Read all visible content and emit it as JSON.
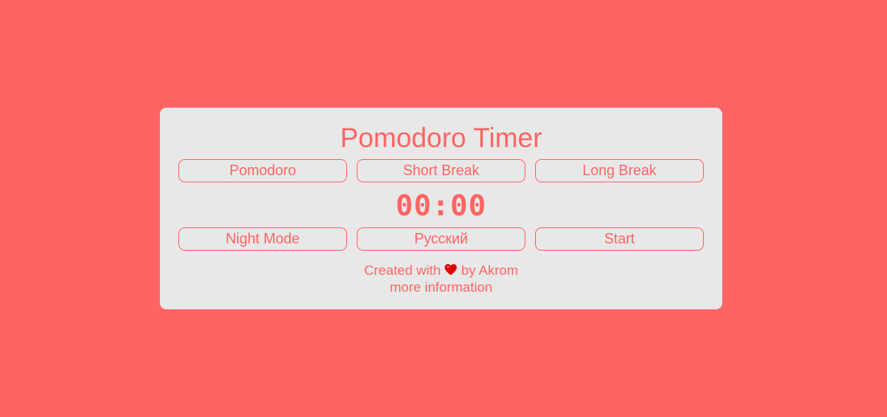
{
  "app": {
    "title": "Pomodoro Timer"
  },
  "modes": [
    {
      "label": "Pomodoro"
    },
    {
      "label": "Short Break"
    },
    {
      "label": "Long Break"
    }
  ],
  "timer": {
    "display": "00:00"
  },
  "controls": {
    "night_mode_label": "Night Mode",
    "language_label": "Русский",
    "start_label": "Start"
  },
  "footer": {
    "created_prefix": "Created with",
    "created_suffix": "by Akrom",
    "heart_icon": "heart-icon",
    "more_info_label": "more information"
  },
  "colors": {
    "background": "#ff6464",
    "card": "#e8e8e8",
    "accent": "#ff6464",
    "heart": "#e00000"
  }
}
